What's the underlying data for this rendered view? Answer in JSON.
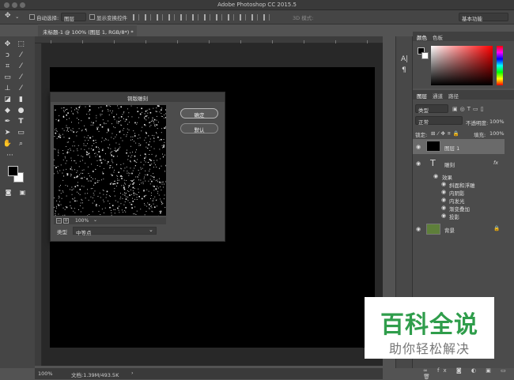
{
  "window": {
    "title": "Adobe Photoshop CC 2015.5"
  },
  "options_bar": {
    "auto_select_label": "自动选择:",
    "auto_select_value": "图层",
    "show_transform_label": "显示变换控件",
    "mode_3d_label": "3D 模式:",
    "workspace_value": "基本功能"
  },
  "document_tab": {
    "label": "未标题-1 @ 100% (图层 1, RGB/8*) *"
  },
  "status_bar": {
    "zoom": "100%",
    "doc_size": "文档:1.39M/493.5K"
  },
  "dialog": {
    "title": "铜版雕刻",
    "ok_label": "确定",
    "default_label": "默认",
    "zoom_value": "100%",
    "type_label": "类型",
    "type_value": "中等点"
  },
  "color_panel": {
    "tabs": [
      "颜色",
      "色板"
    ]
  },
  "layers_panel": {
    "tabs": [
      "图层",
      "通道",
      "路径"
    ],
    "filter_kind": "类型",
    "blend_mode": "正常",
    "opacity_label": "不透明度:",
    "opacity_value": "100%",
    "lock_label": "锁定:",
    "fill_label": "填充:",
    "fill_value": "100%",
    "layers": [
      {
        "name": "图层 1",
        "type": "pixel",
        "thumb_color": "#000000"
      },
      {
        "name": "雕刻",
        "type": "text",
        "fx": "fx"
      },
      {
        "name": "效果",
        "type": "effects-group"
      },
      {
        "name": "斜面和浮雕",
        "type": "effect"
      },
      {
        "name": "内阴影",
        "type": "effect"
      },
      {
        "name": "内发光",
        "type": "effect"
      },
      {
        "name": "渐变叠加",
        "type": "effect"
      },
      {
        "name": "投影",
        "type": "effect"
      },
      {
        "name": "背景",
        "type": "background",
        "thumb_color": "#5e7f3a"
      }
    ]
  },
  "watermark": {
    "line1": "百科全说",
    "line2": "助你轻松解决"
  },
  "colors": {
    "fg": "#000000",
    "bg": "#ffffff",
    "accent_green": "#2f9d4b"
  },
  "icons": [
    "move-icon",
    "marquee-icon",
    "lasso-icon",
    "magic-wand-icon",
    "crop-icon",
    "eyedropper-icon",
    "healing-icon",
    "brush-icon",
    "stamp-icon",
    "history-brush-icon",
    "eraser-icon",
    "gradient-icon",
    "blur-icon",
    "dodge-icon",
    "pen-icon",
    "type-icon",
    "path-select-icon",
    "shape-icon",
    "hand-icon",
    "zoom-icon"
  ]
}
